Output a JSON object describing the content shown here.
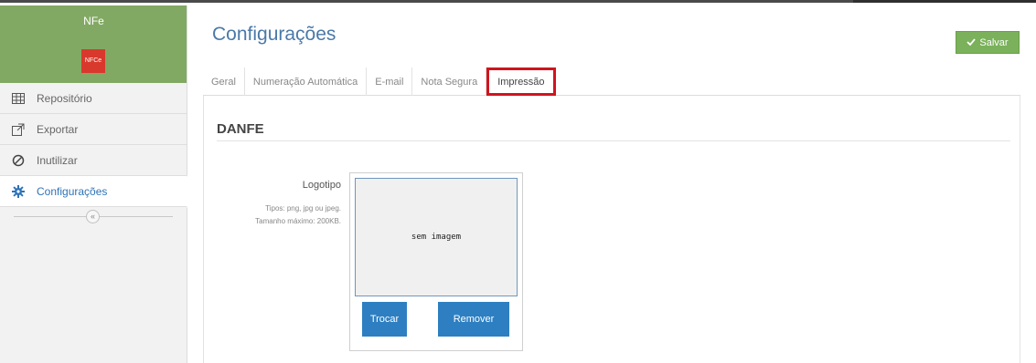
{
  "sidebar": {
    "app_title": "NFe",
    "logo_text": "NFCe",
    "items": [
      {
        "label": "Repositório",
        "icon": "grid-icon"
      },
      {
        "label": "Exportar",
        "icon": "external-link-icon"
      },
      {
        "label": "Inutilizar",
        "icon": "ban-icon"
      },
      {
        "label": "Configurações",
        "icon": "gear-icon",
        "active": true
      }
    ],
    "collapse_glyph": "«"
  },
  "header": {
    "title": "Configurações",
    "save_label": "Salvar"
  },
  "tabs": [
    {
      "label": "Geral"
    },
    {
      "label": "Numeração Automática"
    },
    {
      "label": "E-mail"
    },
    {
      "label": "Nota Segura"
    },
    {
      "label": "Impressão",
      "selected": true
    }
  ],
  "section": {
    "title": "DANFE"
  },
  "logo_field": {
    "label": "Logotipo",
    "hint_line1": "Tipos: png, jpg ou jpeg.",
    "hint_line2": "Tamanho máximo: 200KB.",
    "placeholder": "sem imagem",
    "change_label": "Trocar",
    "remove_label": "Remover"
  },
  "colors": {
    "sidebar_header": "#82a963",
    "accent_blue": "#2d7fc1",
    "save_green": "#7ab15a",
    "tab_highlight": "#d0141e"
  }
}
